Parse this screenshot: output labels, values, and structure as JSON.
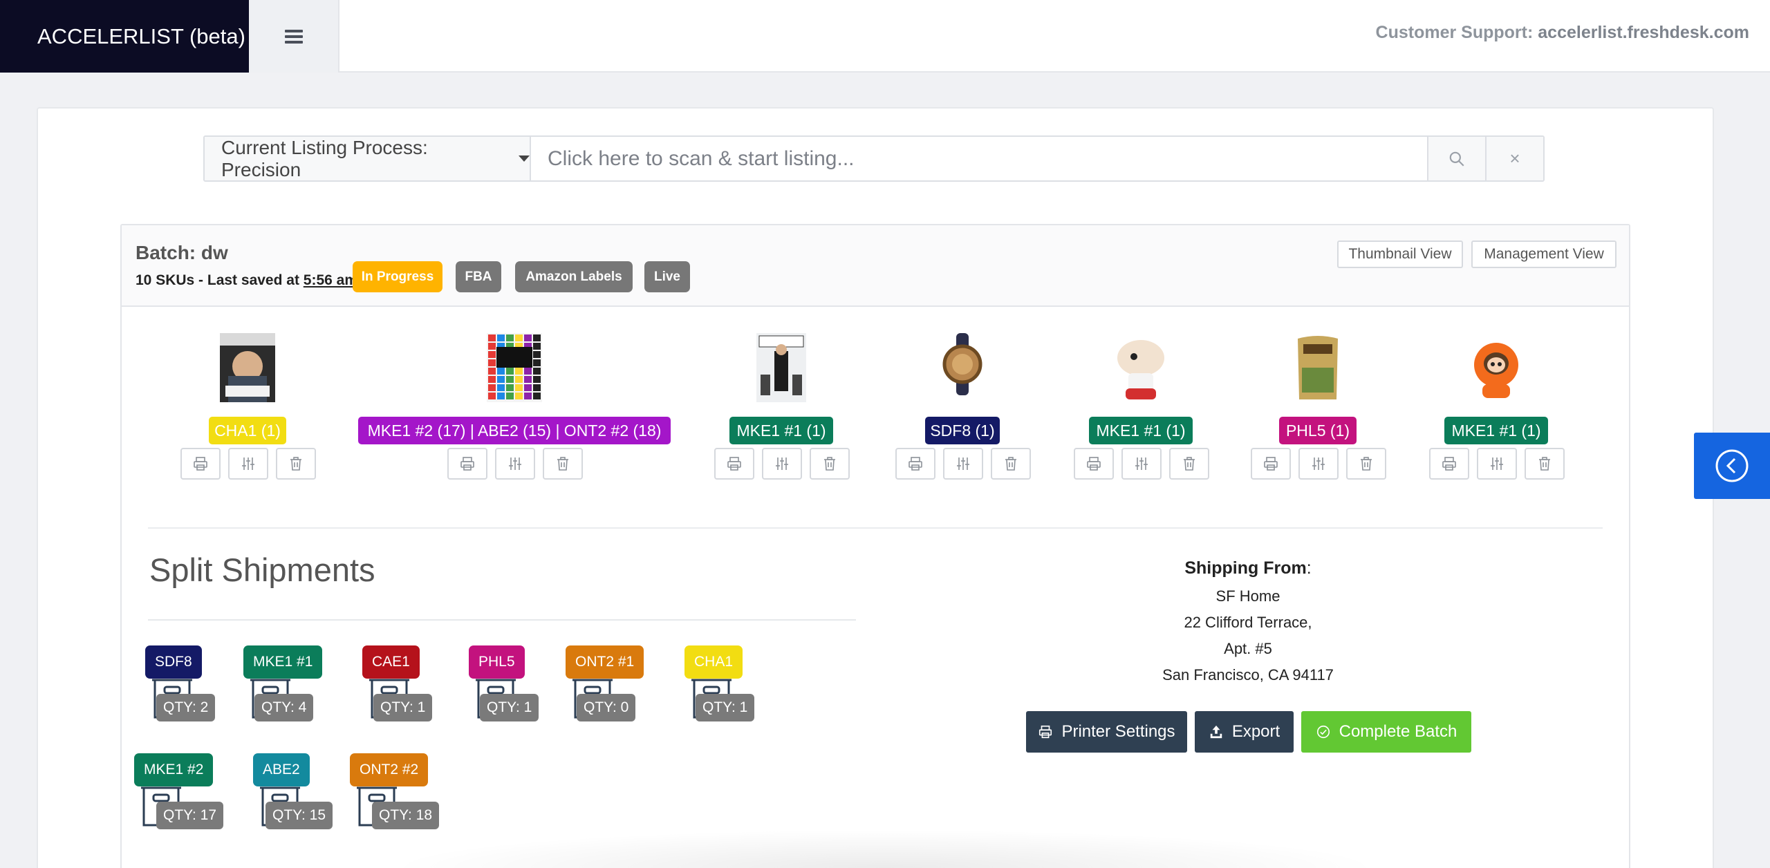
{
  "header": {
    "brand": "ACCELERLIST (beta)",
    "support_label": "Customer Support:",
    "support_link": "accelerlist.freshdesk.com"
  },
  "search": {
    "process_label": "Current Listing Process: Precision",
    "placeholder": "Click here to scan & start listing...",
    "clear_label": "×"
  },
  "batch": {
    "title": "Batch: dw",
    "meta_prefix": "10 SKUs - Last saved at ",
    "saved_time": "5:56 am",
    "tags": [
      "In Progress",
      "FBA",
      "Amazon Labels",
      "Live"
    ],
    "tag_colors": [
      "#ffb300",
      "#777777",
      "#777777",
      "#777777"
    ],
    "views": [
      "Thumbnail View",
      "Management View"
    ]
  },
  "products": [
    {
      "image": "book-cover-dave-ramsey",
      "badge": "CHA1 (1)",
      "color": "#f2dd12"
    },
    {
      "image": "book-cover-fat-chance",
      "badge": "MKE1 #2 (17) | ABE2 (15) | ONT2 #2 (18)",
      "color": "#a416c9"
    },
    {
      "image": "dvd-cover-the-office",
      "badge": "MKE1 #1 (1)",
      "color": "#0b7d5a"
    },
    {
      "image": "wooden-watch",
      "badge": "SDF8 (1)",
      "color": "#141a66"
    },
    {
      "image": "stewie-plush-toy",
      "badge": "MKE1 #1 (1)",
      "color": "#0b7d5a"
    },
    {
      "image": "pet-food-bag",
      "badge": "PHL5 (1)",
      "color": "#c3127e"
    },
    {
      "image": "kenny-plush-toy",
      "badge": "MKE1 #1 (1)",
      "color": "#0b7d5a"
    }
  ],
  "split": {
    "title": "Split Shipments",
    "boxes": [
      {
        "name": "SDF8",
        "qty": "QTY: 2",
        "color": "#141a66"
      },
      {
        "name": "MKE1 #1",
        "qty": "QTY: 4",
        "color": "#0b7d5a"
      },
      {
        "name": "CAE1",
        "qty": "QTY: 1",
        "color": "#b5121b"
      },
      {
        "name": "PHL5",
        "qty": "QTY: 1",
        "color": "#c3127e"
      },
      {
        "name": "ONT2 #1",
        "qty": "QTY: 0",
        "color": "#d97a0d"
      },
      {
        "name": "CHA1",
        "qty": "QTY: 1",
        "color": "#f2dd12"
      },
      {
        "name": "MKE1 #2",
        "qty": "QTY: 17",
        "color": "#0b7d5a"
      },
      {
        "name": "ABE2",
        "qty": "QTY: 15",
        "color": "#138a9e"
      },
      {
        "name": "ONT2 #2",
        "qty": "QTY: 18",
        "color": "#d97a0d"
      }
    ]
  },
  "shipping": {
    "label": "Shipping From",
    "colon": ":",
    "lines": [
      "SF Home",
      "22 Clifford Terrace,",
      "Apt. #5",
      "San Francisco, CA 94117"
    ]
  },
  "actions": {
    "printer": "Printer Settings",
    "export": "Export",
    "complete": "Complete Batch",
    "printer_color": "#2f4052",
    "export_color": "#2f4052",
    "complete_color": "#62c833"
  },
  "sidebar_toggle_color": "#1565e0"
}
